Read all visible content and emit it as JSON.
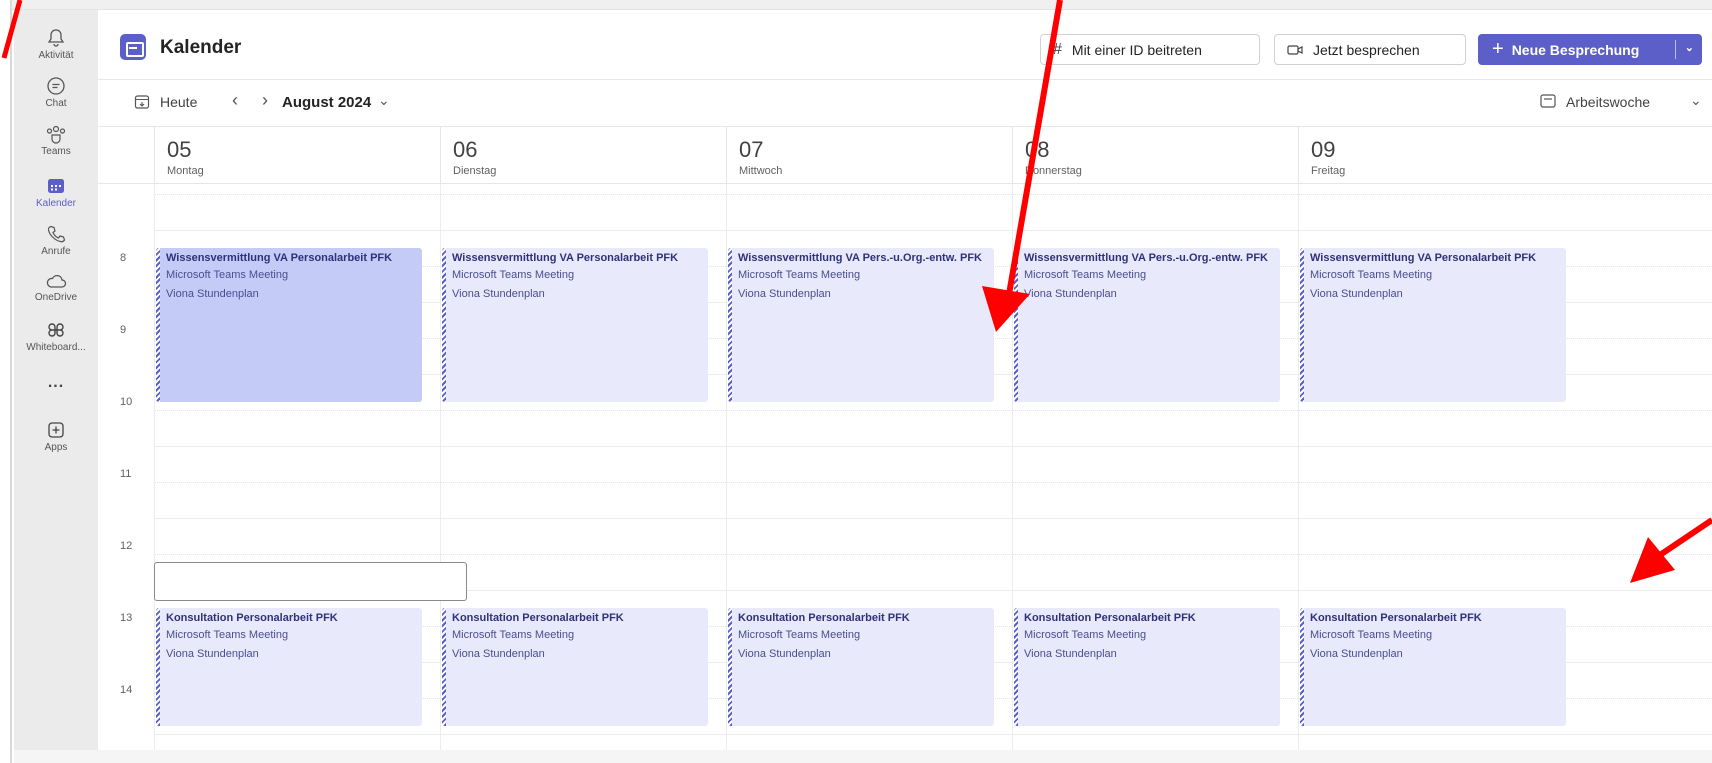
{
  "rail": {
    "items": [
      {
        "label": "Aktivität",
        "icon": "bell-icon"
      },
      {
        "label": "Chat",
        "icon": "chat-icon"
      },
      {
        "label": "Teams",
        "icon": "teams-icon"
      },
      {
        "label": "Kalender",
        "icon": "calendar-icon",
        "active": true
      },
      {
        "label": "Anrufe",
        "icon": "phone-icon"
      },
      {
        "label": "OneDrive",
        "icon": "cloud-icon"
      },
      {
        "label": "Whiteboard...",
        "icon": "whiteboard-icon"
      },
      {
        "label": "...",
        "icon": "more-icon"
      },
      {
        "label": "Apps",
        "icon": "apps-icon"
      }
    ]
  },
  "header": {
    "title": "Kalender",
    "join_id_label": "Mit einer ID beitreten",
    "meet_now_label": "Jetzt besprechen",
    "new_meeting_label": "Neue Besprechung"
  },
  "toolbar": {
    "today_label": "Heute",
    "month_label": "August 2024",
    "view_label": "Arbeitswoche"
  },
  "days": [
    {
      "num": "05",
      "name": "Montag"
    },
    {
      "num": "06",
      "name": "Dienstag"
    },
    {
      "num": "07",
      "name": "Mittwoch"
    },
    {
      "num": "08",
      "name": "Donnerstag"
    },
    {
      "num": "09",
      "name": "Freitag"
    }
  ],
  "hours": [
    "8",
    "9",
    "10",
    "11",
    "12",
    "13",
    "14"
  ],
  "morning_events": [
    {
      "title": "Wissensvermittlung VA Personalarbeit PFK",
      "line1": "Microsoft Teams Meeting",
      "line2": "Viona Stundenplan"
    },
    {
      "title": "Wissensvermittlung VA Personalarbeit PFK",
      "line1": "Microsoft Teams Meeting",
      "line2": "Viona Stundenplan"
    },
    {
      "title": "Wissensvermittlung VA Pers.-u.Org.-entw. PFK",
      "line1": "Microsoft Teams Meeting",
      "line2": "Viona Stundenplan"
    },
    {
      "title": "Wissensvermittlung VA Pers.-u.Org.-entw. PFK",
      "line1": "Microsoft Teams Meeting",
      "line2": "Viona Stundenplan"
    },
    {
      "title": "Wissensvermittlung VA Personalarbeit PFK",
      "line1": "Microsoft Teams Meeting",
      "line2": "Viona Stundenplan"
    }
  ],
  "afternoon_events": [
    {
      "title": "Konsultation Personalarbeit PFK",
      "line1": "Microsoft Teams Meeting",
      "line2": "Viona Stundenplan"
    },
    {
      "title": "Konsultation Personalarbeit PFK",
      "line1": "Microsoft Teams Meeting",
      "line2": "Viona Stundenplan"
    },
    {
      "title": "Konsultation Personalarbeit PFK",
      "line1": "Microsoft Teams Meeting",
      "line2": "Viona Stundenplan"
    },
    {
      "title": "Konsultation Personalarbeit PFK",
      "line1": "Microsoft Teams Meeting",
      "line2": "Viona Stundenplan"
    },
    {
      "title": "Konsultation Personalarbeit PFK",
      "line1": "Microsoft Teams Meeting",
      "line2": "Viona Stundenplan"
    }
  ],
  "colors": {
    "accent": "#5b5fc7",
    "event_bg": "#e8eafb",
    "event_selected_bg": "#c5cbf7",
    "annotation": "#ff0000"
  }
}
